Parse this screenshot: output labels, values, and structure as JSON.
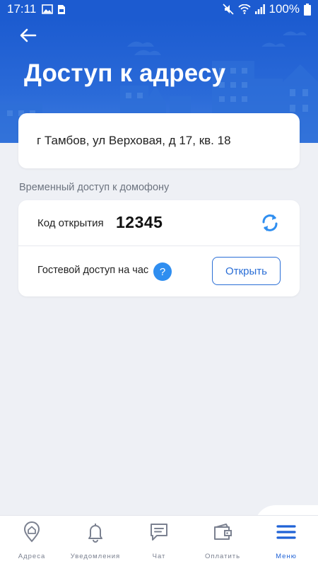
{
  "status_bar": {
    "time": "17:11",
    "battery": "100%",
    "icons": [
      "image-icon",
      "sim-icon",
      "mute-icon",
      "wifi-icon",
      "signal-icon",
      "battery-icon"
    ]
  },
  "header": {
    "title": "Доступ к адресу",
    "back_icon": "arrow-left-icon"
  },
  "address": {
    "text": "г Тамбов, ул Верховая, д 17, кв. 18"
  },
  "intercom": {
    "section_label": "Временный доступ к домофону",
    "code_label": "Код открытия",
    "code_value": "12345",
    "refresh_icon": "refresh-icon",
    "guest_label": "Гостевой доступ на час",
    "help_glyph": "?",
    "open_label": "Открыть"
  },
  "nav": {
    "items": [
      {
        "label": "Адреса",
        "icon": "house-pin-icon"
      },
      {
        "label": "Уведомления",
        "icon": "bell-icon"
      },
      {
        "label": "Чат",
        "icon": "chat-icon"
      },
      {
        "label": "Оплатить",
        "icon": "wallet-icon"
      },
      {
        "label": "Меню",
        "icon": "hamburger-icon"
      }
    ],
    "active_index": 4
  },
  "colors": {
    "brand_blue": "#1c5bd0",
    "accent_blue": "#2a6ed6",
    "help_blue": "#2f8ef0",
    "background": "#eef0f5"
  }
}
